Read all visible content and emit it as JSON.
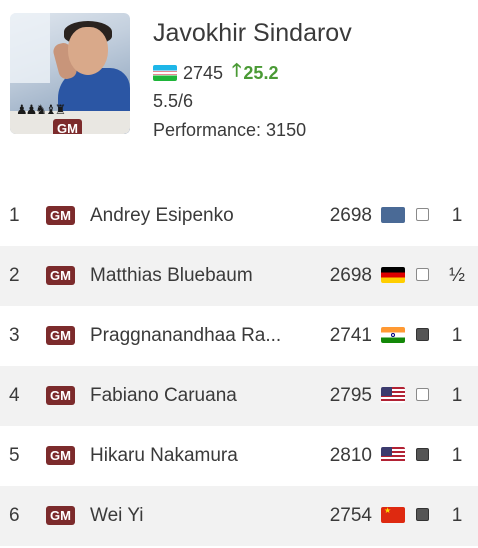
{
  "player": {
    "name": "Javokhir Sindarov",
    "title": "GM",
    "flag": "uzbekistan-flag",
    "rating": "2745",
    "rating_change": "25.2",
    "score": "5.5/6",
    "performance": "Performance: 3150"
  },
  "colors": {
    "title_badge": "#7c2b2c",
    "gain": "#4a9a35",
    "row_alt": "#f2f2f2"
  },
  "games": [
    {
      "round": "1",
      "title": "GM",
      "opponent": "Andrey Esipenko",
      "rating": "2698",
      "flag": "fide-flag",
      "color": "white",
      "result": "1"
    },
    {
      "round": "2",
      "title": "GM",
      "opponent": "Matthias Bluebaum",
      "rating": "2698",
      "flag": "germany-flag",
      "color": "white",
      "result": "½"
    },
    {
      "round": "3",
      "title": "GM",
      "opponent": "Praggnanandhaa Ra...",
      "rating": "2741",
      "flag": "india-flag",
      "color": "black",
      "result": "1"
    },
    {
      "round": "4",
      "title": "GM",
      "opponent": "Fabiano Caruana",
      "rating": "2795",
      "flag": "usa-flag",
      "color": "white",
      "result": "1"
    },
    {
      "round": "5",
      "title": "GM",
      "opponent": "Hikaru Nakamura",
      "rating": "2810",
      "flag": "usa-flag",
      "color": "black",
      "result": "1"
    },
    {
      "round": "6",
      "title": "GM",
      "opponent": "Wei Yi",
      "rating": "2754",
      "flag": "china-flag",
      "color": "black",
      "result": "1"
    }
  ]
}
